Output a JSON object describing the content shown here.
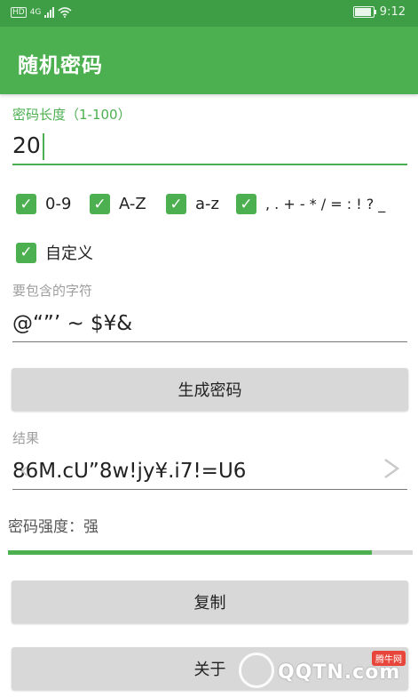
{
  "status_bar": {
    "network_badge": "HD",
    "network_type": "4G",
    "time": "9:12",
    "icons": [
      "hd-icon",
      "signal-icon",
      "wifi-icon",
      "battery-icon"
    ]
  },
  "app_bar": {
    "title": "随机密码"
  },
  "length": {
    "label": "密码长度（1-100）",
    "value": "20"
  },
  "options": [
    {
      "label": "0-9",
      "checked": true
    },
    {
      "label": "A-Z",
      "checked": true
    },
    {
      "label": "a-z",
      "checked": true
    },
    {
      "label": ", . + - * / = : ! ? _",
      "checked": true
    },
    {
      "label": "自定义",
      "checked": true
    }
  ],
  "custom": {
    "label": "要包含的字符",
    "value": "@“”’ ~ $¥&"
  },
  "generate_button": "生成密码",
  "result": {
    "label": "结果",
    "value": "86M.cU”8w!jy¥.i7!=U6"
  },
  "strength": {
    "text": "密码强度：强",
    "level_percent": 90
  },
  "copy_button": "复制",
  "about_button": "关于",
  "watermark": {
    "text": "QQTN.com",
    "badge": "腾牛网"
  },
  "colors": {
    "primary": "#4caf50",
    "status_bar": "#3d9e45",
    "button_bg": "#d8d8d8"
  }
}
